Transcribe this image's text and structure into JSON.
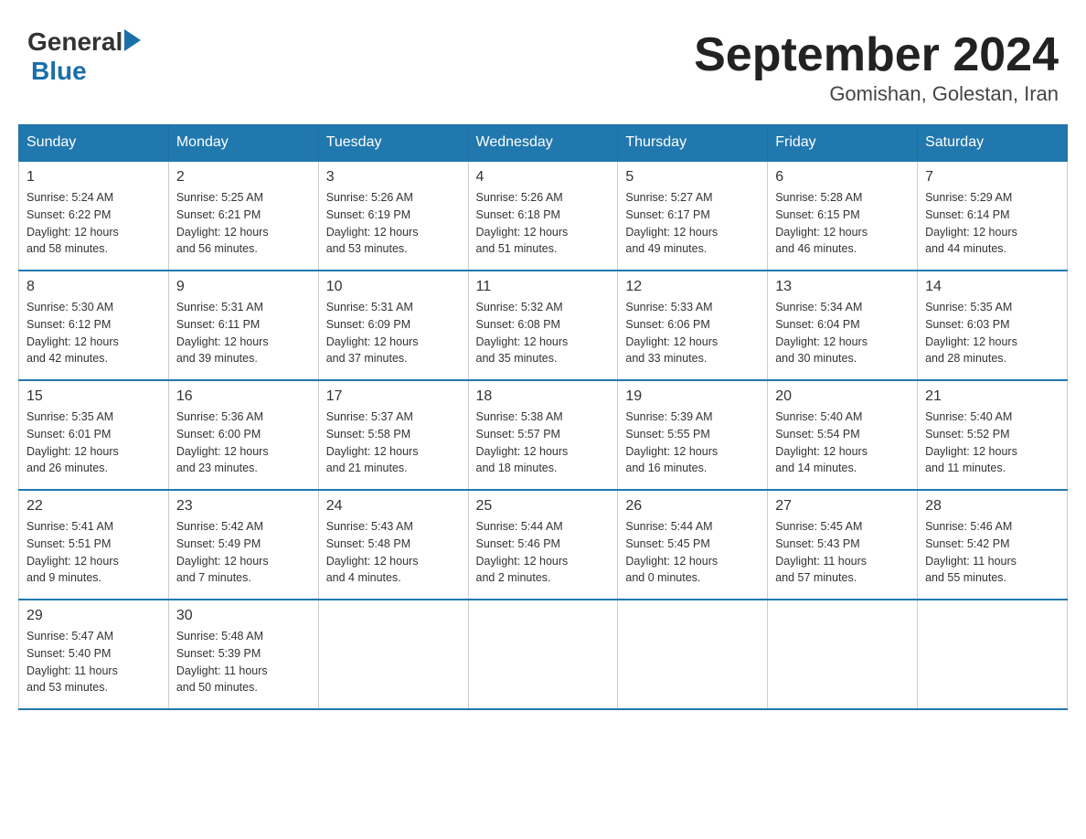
{
  "header": {
    "logo_text_general": "General",
    "logo_text_blue": "Blue",
    "month_title": "September 2024",
    "location": "Gomishan, Golestan, Iran"
  },
  "days_of_week": [
    "Sunday",
    "Monday",
    "Tuesday",
    "Wednesday",
    "Thursday",
    "Friday",
    "Saturday"
  ],
  "weeks": [
    [
      {
        "day": "1",
        "info": "Sunrise: 5:24 AM\nSunset: 6:22 PM\nDaylight: 12 hours\nand 58 minutes."
      },
      {
        "day": "2",
        "info": "Sunrise: 5:25 AM\nSunset: 6:21 PM\nDaylight: 12 hours\nand 56 minutes."
      },
      {
        "day": "3",
        "info": "Sunrise: 5:26 AM\nSunset: 6:19 PM\nDaylight: 12 hours\nand 53 minutes."
      },
      {
        "day": "4",
        "info": "Sunrise: 5:26 AM\nSunset: 6:18 PM\nDaylight: 12 hours\nand 51 minutes."
      },
      {
        "day": "5",
        "info": "Sunrise: 5:27 AM\nSunset: 6:17 PM\nDaylight: 12 hours\nand 49 minutes."
      },
      {
        "day": "6",
        "info": "Sunrise: 5:28 AM\nSunset: 6:15 PM\nDaylight: 12 hours\nand 46 minutes."
      },
      {
        "day": "7",
        "info": "Sunrise: 5:29 AM\nSunset: 6:14 PM\nDaylight: 12 hours\nand 44 minutes."
      }
    ],
    [
      {
        "day": "8",
        "info": "Sunrise: 5:30 AM\nSunset: 6:12 PM\nDaylight: 12 hours\nand 42 minutes."
      },
      {
        "day": "9",
        "info": "Sunrise: 5:31 AM\nSunset: 6:11 PM\nDaylight: 12 hours\nand 39 minutes."
      },
      {
        "day": "10",
        "info": "Sunrise: 5:31 AM\nSunset: 6:09 PM\nDaylight: 12 hours\nand 37 minutes."
      },
      {
        "day": "11",
        "info": "Sunrise: 5:32 AM\nSunset: 6:08 PM\nDaylight: 12 hours\nand 35 minutes."
      },
      {
        "day": "12",
        "info": "Sunrise: 5:33 AM\nSunset: 6:06 PM\nDaylight: 12 hours\nand 33 minutes."
      },
      {
        "day": "13",
        "info": "Sunrise: 5:34 AM\nSunset: 6:04 PM\nDaylight: 12 hours\nand 30 minutes."
      },
      {
        "day": "14",
        "info": "Sunrise: 5:35 AM\nSunset: 6:03 PM\nDaylight: 12 hours\nand 28 minutes."
      }
    ],
    [
      {
        "day": "15",
        "info": "Sunrise: 5:35 AM\nSunset: 6:01 PM\nDaylight: 12 hours\nand 26 minutes."
      },
      {
        "day": "16",
        "info": "Sunrise: 5:36 AM\nSunset: 6:00 PM\nDaylight: 12 hours\nand 23 minutes."
      },
      {
        "day": "17",
        "info": "Sunrise: 5:37 AM\nSunset: 5:58 PM\nDaylight: 12 hours\nand 21 minutes."
      },
      {
        "day": "18",
        "info": "Sunrise: 5:38 AM\nSunset: 5:57 PM\nDaylight: 12 hours\nand 18 minutes."
      },
      {
        "day": "19",
        "info": "Sunrise: 5:39 AM\nSunset: 5:55 PM\nDaylight: 12 hours\nand 16 minutes."
      },
      {
        "day": "20",
        "info": "Sunrise: 5:40 AM\nSunset: 5:54 PM\nDaylight: 12 hours\nand 14 minutes."
      },
      {
        "day": "21",
        "info": "Sunrise: 5:40 AM\nSunset: 5:52 PM\nDaylight: 12 hours\nand 11 minutes."
      }
    ],
    [
      {
        "day": "22",
        "info": "Sunrise: 5:41 AM\nSunset: 5:51 PM\nDaylight: 12 hours\nand 9 minutes."
      },
      {
        "day": "23",
        "info": "Sunrise: 5:42 AM\nSunset: 5:49 PM\nDaylight: 12 hours\nand 7 minutes."
      },
      {
        "day": "24",
        "info": "Sunrise: 5:43 AM\nSunset: 5:48 PM\nDaylight: 12 hours\nand 4 minutes."
      },
      {
        "day": "25",
        "info": "Sunrise: 5:44 AM\nSunset: 5:46 PM\nDaylight: 12 hours\nand 2 minutes."
      },
      {
        "day": "26",
        "info": "Sunrise: 5:44 AM\nSunset: 5:45 PM\nDaylight: 12 hours\nand 0 minutes."
      },
      {
        "day": "27",
        "info": "Sunrise: 5:45 AM\nSunset: 5:43 PM\nDaylight: 11 hours\nand 57 minutes."
      },
      {
        "day": "28",
        "info": "Sunrise: 5:46 AM\nSunset: 5:42 PM\nDaylight: 11 hours\nand 55 minutes."
      }
    ],
    [
      {
        "day": "29",
        "info": "Sunrise: 5:47 AM\nSunset: 5:40 PM\nDaylight: 11 hours\nand 53 minutes."
      },
      {
        "day": "30",
        "info": "Sunrise: 5:48 AM\nSunset: 5:39 PM\nDaylight: 11 hours\nand 50 minutes."
      },
      {
        "day": "",
        "info": ""
      },
      {
        "day": "",
        "info": ""
      },
      {
        "day": "",
        "info": ""
      },
      {
        "day": "",
        "info": ""
      },
      {
        "day": "",
        "info": ""
      }
    ]
  ]
}
